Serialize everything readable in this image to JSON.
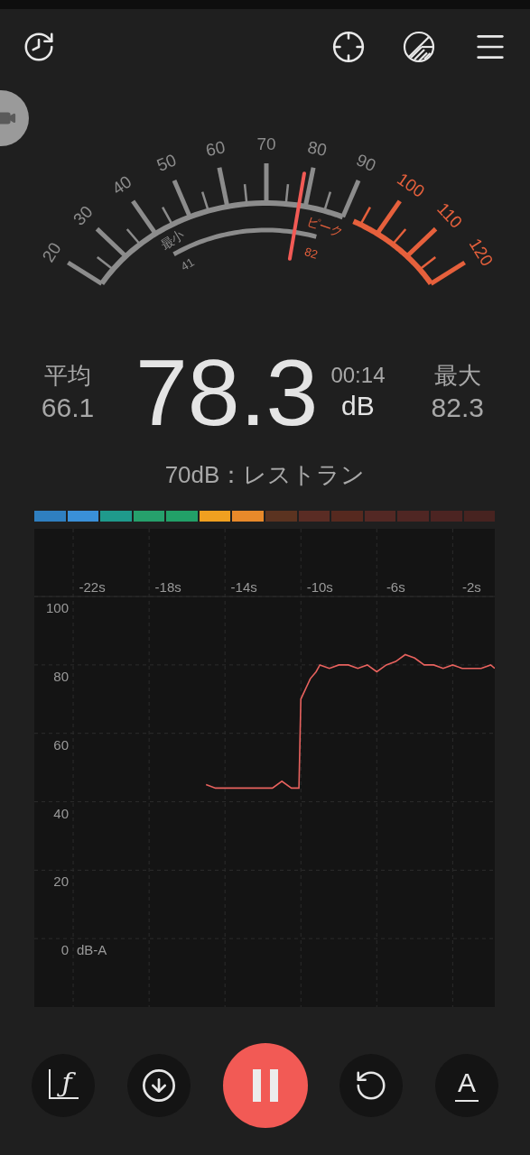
{
  "gauge": {
    "scale": [
      {
        "text": "20",
        "kind": "normal"
      },
      {
        "text": "30",
        "kind": "normal"
      },
      {
        "text": "40",
        "kind": "normal"
      },
      {
        "text": "50",
        "kind": "normal"
      },
      {
        "text": "60",
        "kind": "normal"
      },
      {
        "text": "70",
        "kind": "normal"
      },
      {
        "text": "80",
        "kind": "normal"
      },
      {
        "text": "90",
        "kind": "normal"
      },
      {
        "text": "100",
        "kind": "loud"
      },
      {
        "text": "110",
        "kind": "loud"
      },
      {
        "text": "120",
        "kind": "loud"
      }
    ],
    "level": 0.583,
    "minimum": {
      "label": "最小",
      "reading": "41"
    },
    "peak": {
      "label": "ピーク",
      "reading": "82"
    }
  },
  "stats": {
    "average": {
      "label": "平均",
      "value": "66.1"
    },
    "current": {
      "value": "78.3",
      "time": "00:14",
      "unit": "dB"
    },
    "maximum": {
      "label": "最大",
      "value": "82.3"
    }
  },
  "reference": "70dB：レストラン",
  "color_scale": [
    {
      "color": "#2f7fc0"
    },
    {
      "color": "#3a90d8"
    },
    {
      "color": "#1f9a8c"
    },
    {
      "color": "#26a06c"
    },
    {
      "color": "#22a068"
    },
    {
      "color": "#f0a020"
    },
    {
      "color": "#e8892a"
    },
    {
      "color": "#5b3320"
    },
    {
      "color": "#5a2c24"
    },
    {
      "color": "#56291f"
    },
    {
      "color": "#532824"
    },
    {
      "color": "#4f2623"
    },
    {
      "color": "#4c2422"
    },
    {
      "color": "#472320"
    }
  ],
  "chart": {
    "chart_data": {
      "type": "line",
      "ylabel": "dB-A",
      "xlim": [
        -25.05,
        -0.78
      ],
      "ylim": [
        -20,
        119.8
      ],
      "grid": true,
      "xticks": [
        {
          "value": -22,
          "label": "-22s"
        },
        {
          "value": -18,
          "label": "-18s"
        },
        {
          "value": -14,
          "label": "-14s"
        },
        {
          "value": -10,
          "label": "-10s"
        },
        {
          "value": -6,
          "label": "-6s"
        },
        {
          "value": -2,
          "label": "-2s"
        }
      ],
      "yticks": [
        0,
        20,
        40,
        60,
        80,
        100
      ],
      "x": [
        -16,
        -15.5,
        -15,
        -14.5,
        -14,
        -13.5,
        -13,
        -12.5,
        -12,
        -11.5,
        -11.1,
        -11,
        -10.5,
        -10.2,
        -10,
        -9.5,
        -9,
        -8.5,
        -8,
        -7.5,
        -7,
        -6.5,
        -6,
        -5.5,
        -5,
        -4.5,
        -4,
        -3.5,
        -3,
        -2.5,
        -2,
        -1.5,
        -1,
        -0.78
      ],
      "series": [
        {
          "color": "#e8625e",
          "values": [
            45,
            44,
            44,
            44,
            44,
            44,
            44,
            44,
            46,
            44,
            44,
            70,
            76,
            78,
            80,
            79,
            80,
            80,
            79,
            80,
            78,
            80,
            81,
            83,
            82,
            80,
            80,
            79,
            80,
            79,
            79,
            79,
            80,
            79
          ]
        }
      ]
    }
  },
  "controls": [
    {
      "kind": "curve",
      "text": "ƒ"
    },
    {
      "kind": "save"
    },
    {
      "kind": "pause"
    },
    {
      "kind": "reset"
    },
    {
      "kind": "weighting",
      "text": "A"
    }
  ]
}
